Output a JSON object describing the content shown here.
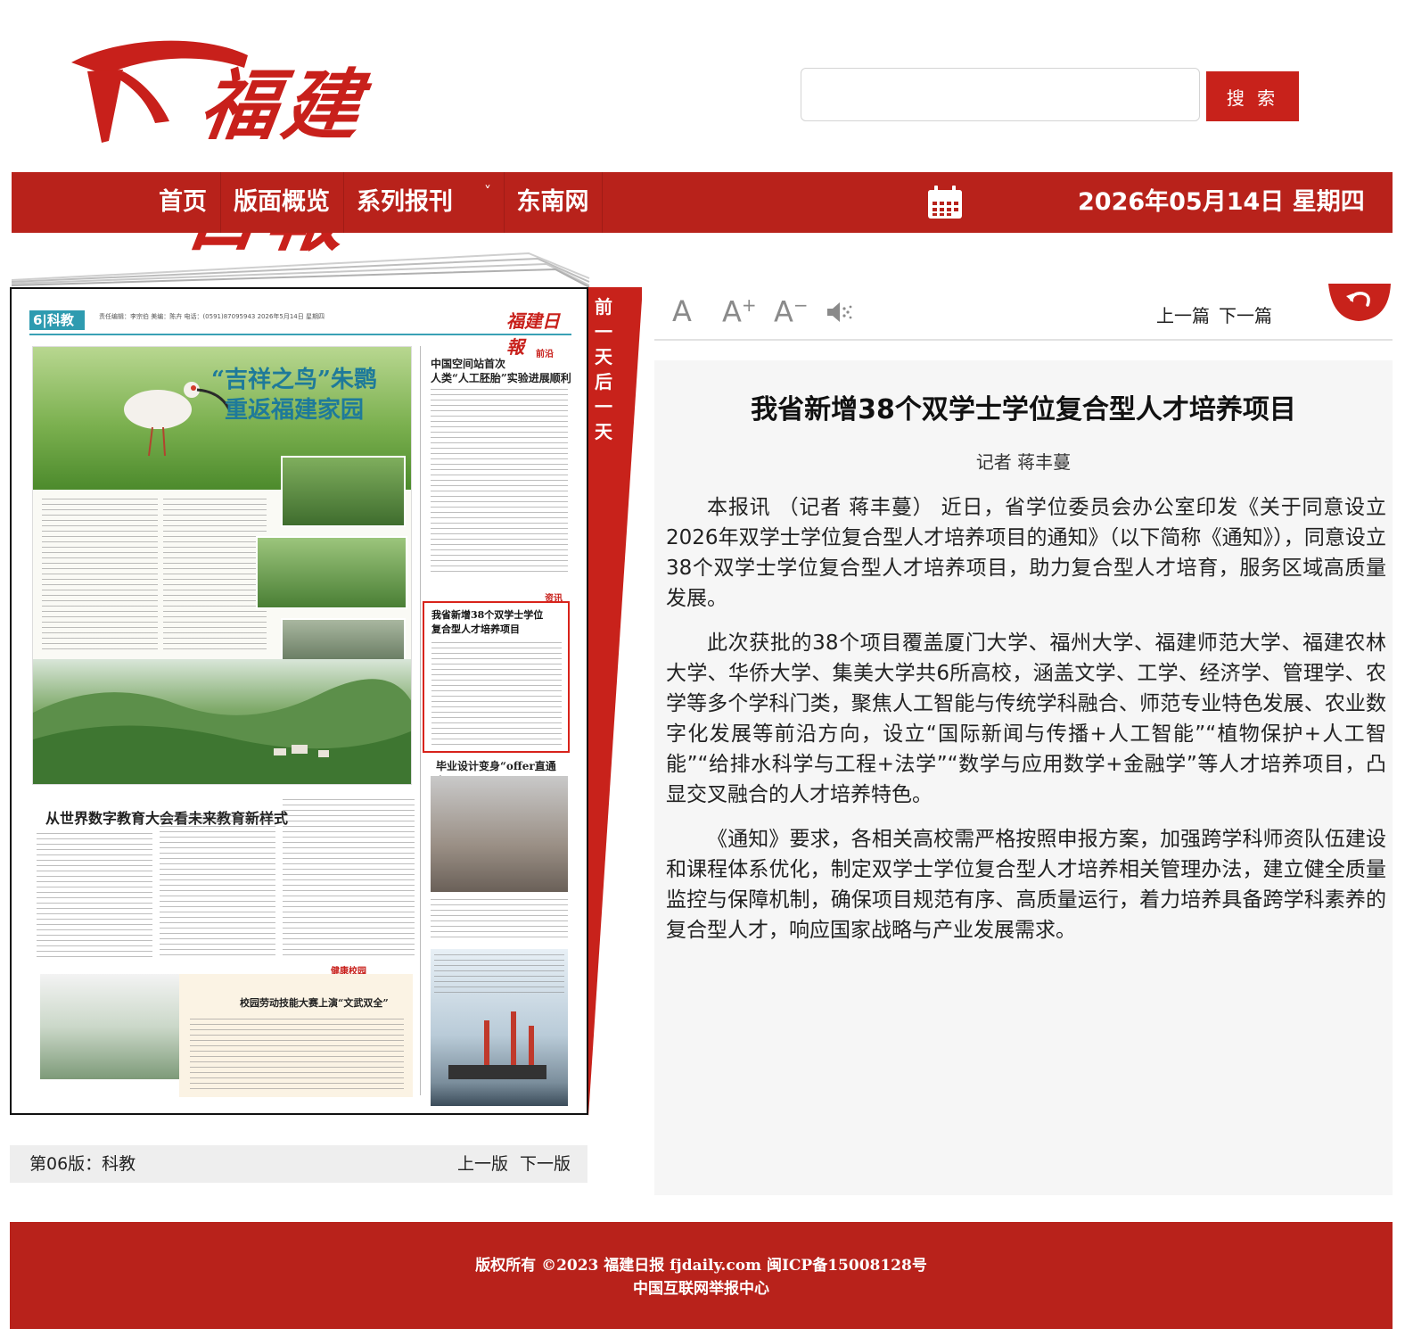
{
  "header": {
    "logo_text": "福建日報",
    "search_placeholder": "",
    "search_button": "搜 索"
  },
  "nav": {
    "items": [
      "首页",
      "版面概览",
      "系列报刊",
      "东南网"
    ],
    "dropdown_caret": "˅",
    "date": "2026年05月14日 星期四"
  },
  "paper": {
    "section_num": "6|科教",
    "header_small": "责任编辑：李宗伯 美编：陈卉 电话：(0591)87095943  2026年5月14日 星期四",
    "masthead": "福建日報",
    "main_caption_line1": "“吉祥之鸟”朱鹮",
    "main_caption_line2": "重返福建家园",
    "right_head1_line1": "中国空间站首次",
    "right_head1_line2": "人类“人工胚胎”实验进展顺利",
    "tag_qianyan": "前沿",
    "tag_zixun": "资讯",
    "highlight_title_line1": "我省新增38个双学士学位",
    "highlight_title_line2": "复合型人才培养项目",
    "right_head2": "毕业设计变身“offer直通车”",
    "left_head2": "从世界数字教育大会看未来教育新样式",
    "tag_jiankang": "健康校园",
    "bottom_title": "校园劳动技能大赛上演“文武双全”"
  },
  "day_tab": {
    "prev_day": [
      "前",
      "一",
      "天"
    ],
    "next_day": [
      "后",
      "一",
      "天"
    ]
  },
  "page_footer": {
    "label": "第06版：科教",
    "prev": "上一版",
    "next": "下一版"
  },
  "toolbar": {
    "font_default": "A",
    "font_plus": "A",
    "plus_sign": "+",
    "font_minus": "A",
    "minus_sign": "−",
    "prev_article": "上一篇",
    "next_article": "下一篇"
  },
  "article": {
    "title": "我省新增38个双学士学位复合型人才培养项目",
    "author": "记者 蒋丰蔓",
    "paragraphs": [
      "本报讯 （记者 蒋丰蔓） 近日，省学位委员会办公室印发《关于同意设立2026年双学士学位复合型人才培养项目的通知》（以下简称《通知》），同意设立38个双学士学位复合型人才培养项目，助力复合型人才培育，服务区域高质量发展。",
      "此次获批的38个项目覆盖厦门大学、福州大学、福建师范大学、福建农林大学、华侨大学、集美大学共6所高校，涵盖文学、工学、经济学、管理学、农学等多个学科门类，聚焦人工智能与传统学科融合、师范专业特色发展、农业数字化发展等前沿方向，设立“国际新闻与传播+人工智能”“植物保护+人工智能”“给排水科学与工程+法学”“数学与应用数学+金融学”等人才培养项目，凸显交叉融合的人才培养特色。",
      "《通知》要求，各相关高校需严格按照申报方案，加强跨学科师资队伍建设和课程体系优化，制定双学士学位复合型人才培养相关管理办法，建立健全质量监控与保障机制，确保项目规范有序、高质量运行，着力培养具备跨学科素养的复合型人才，响应国家战略与产业发展需求。"
    ]
  },
  "footer": {
    "copyright": "版权所有 ©2023 福建日报 fjdaily.com 闽ICP备15008128号",
    "report": "中国互联网举报中心"
  },
  "colors": {
    "brand_red": "#b8221b",
    "button_red": "#c8221b",
    "teal": "#2e9bb0"
  }
}
